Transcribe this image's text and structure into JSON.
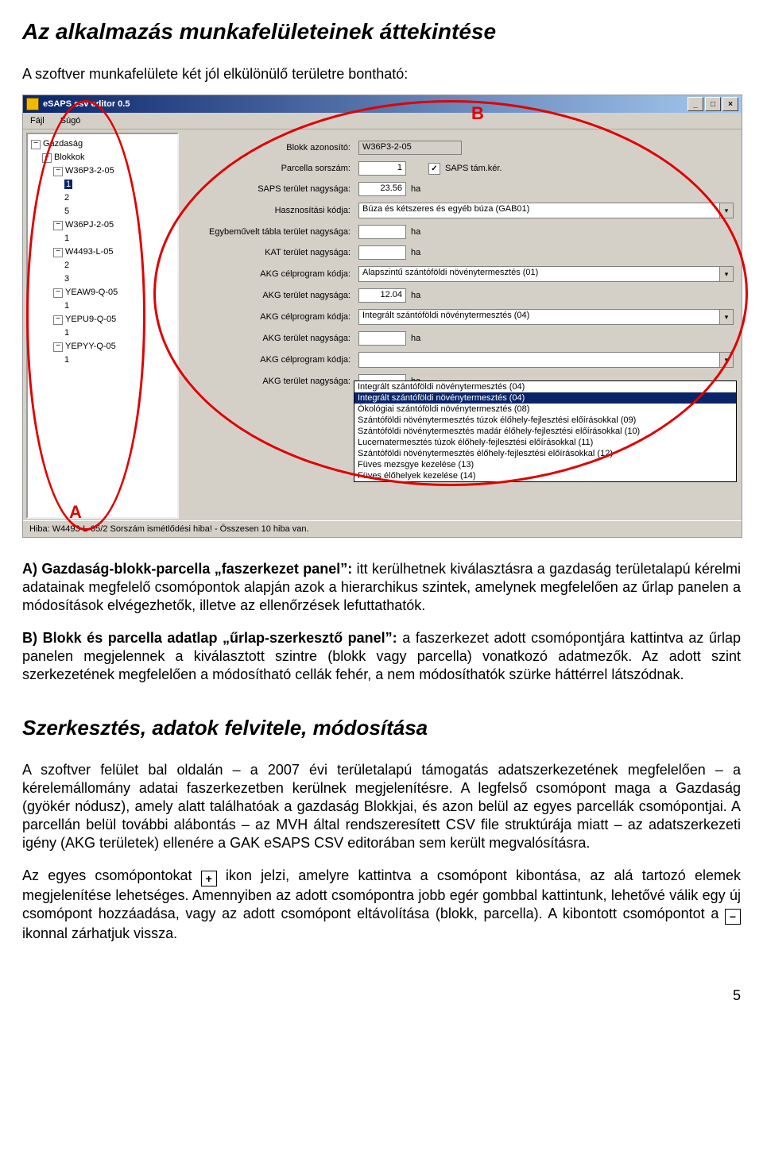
{
  "doc": {
    "heading1": "Az alkalmazás munkafelületeinek áttekintése",
    "intro": "A szoftver munkafelülete két jól elkülönülő területre bontható:",
    "sectionA_lead": "A) Gazdaság-blokk-parcella „faszerkezet panel”:",
    "sectionA_rest": " itt kerülhetnek kiválasztásra a gazdaság területalapú kérelmi adatainak megfelelő csomópontok alapján azok a hierarchikus szintek, amelynek megfelelően az űrlap panelen a módosítások elvégezhetők, illetve az ellenőrzések lefuttathatók.",
    "sectionB_lead": "B) Blokk és parcella adatlap „űrlap-szerkesztő panel”:",
    "sectionB_rest": " a faszerkezet adott csomópontjára kattintva az űrlap panelen megjelennek a kiválasztott szintre (blokk vagy parcella) vonatkozó adatmezők. Az adott szint szerkezetének megfelelően a módosítható cellák fehér, a nem módosíthatók szürke háttérrel látszódnak.",
    "heading2": "Szerkesztés, adatok felvitele, módosítása",
    "para2": "A szoftver felület bal oldalán – a 2007 évi területalapú támogatás adatszerkezetének megfelelően – a kérelemállomány adatai faszerkezetben kerülnek megjelenítésre. A legfelső csomópont maga a Gazdaság (gyökér nódusz), amely alatt találhatóak a gazdaság Blokkjai, és azon belül az egyes parcellák csomópontjai. A parcellán belül további alábontás – az MVH által rendszeresített CSV file struktúrája miatt – az adatszerkezeti igény (AKG területek) ellenére a GAK eSAPS CSV editorában sem került megvalósításra.",
    "para3_a": "Az egyes csomópontokat ",
    "para3_b": " ikon jelzi, amelyre kattintva a csomópont kibontása, az alá tartozó elemek megjelenítése lehetséges. Amennyiben az adott csomópontra jobb egér gombbal kattintunk, lehetővé válik egy új csomópont hozzáadása, vagy az adott csomópont eltávolítása  (blokk, parcella). A kibontott csomópontot a ",
    "para3_c": " ikonnal zárhatjuk vissza.",
    "page_number": "5",
    "plus_icon": "+",
    "minus_icon": "−"
  },
  "app": {
    "title": "eSAPS csv editor 0.5",
    "menu": {
      "file": "Fájl",
      "help": "Súgó"
    },
    "win_min": "_",
    "win_max": "□",
    "win_close": "×",
    "tree": {
      "root": "Gazdaság",
      "blokkok": "Blokkok",
      "items": [
        {
          "block": "W36P3-2-05",
          "children": [
            "1",
            "2",
            "5"
          ],
          "sel": 0
        },
        {
          "block": "W36PJ-2-05",
          "children": [
            "1"
          ]
        },
        {
          "block": "W4493-L-05",
          "children": [
            "2",
            "3"
          ]
        },
        {
          "block": "YEAW9-Q-05",
          "children": [
            "1"
          ]
        },
        {
          "block": "YEPU9-Q-05",
          "children": [
            "1"
          ]
        },
        {
          "block": "YEPYY-Q-05",
          "children": [
            "1"
          ]
        }
      ],
      "collapsed_glyph": "−"
    },
    "form": {
      "mark_a": "A",
      "mark_b": "B",
      "labels": {
        "blokk_az": "Blokk azonosító:",
        "parc_sor": "Parcella sorszám:",
        "saps_ter": "SAPS terület nagysága:",
        "haszn": "Hasznosítási kódja:",
        "egybe": "Egybeművelt tábla terület nagysága:",
        "kat": "KAT terület nagysága:",
        "akg_kod": "AKG célprogram kódja:",
        "akg_ter": "AKG terület nagysága:",
        "saps_tam": "SAPS tám.kér."
      },
      "values": {
        "blokk_az": "W36P3-2-05",
        "parc_sor": "1",
        "saps_ter": "23.56",
        "haszn": "Búza és kétszeres és egyéb búza (GAB01)",
        "egybe": "",
        "kat": "",
        "akg_kod1": "Alapszintű szántóföldi növénytermesztés (01)",
        "akg_ter1": "12.04",
        "akg_kod2": "Integrált szántóföldi növénytermesztés (04)",
        "akg_ter2": "",
        "akg_kod3": "",
        "akg_ter3": "",
        "saps_checked": "✓",
        "ha": "ha"
      },
      "listbox": [
        "Integrált szántóföldi növénytermesztés (04)",
        "Ökológiai szántóföldi növénytermesztés (08)",
        "Szántóföldi növénytermesztés túzok élőhely-fejlesztési előírásokkal (09)",
        "Szántóföldi növénytermesztés madár élőhely-fejlesztési előírásokkal (10)",
        "Lucernatermesztés túzok élőhely-fejlesztési előírásokkal (11)",
        "Szántóföldi növénytermesztés élőhely-fejlesztési előírásokkal (12)",
        "Füves mezsgye kezelése (13)",
        "Füves élőhelyek kezelése (14)"
      ]
    },
    "statusbar": "Hiba: W4493-L-05/2 Sorszám ismétlődési hiba! - Összesen 10 hiba van."
  }
}
